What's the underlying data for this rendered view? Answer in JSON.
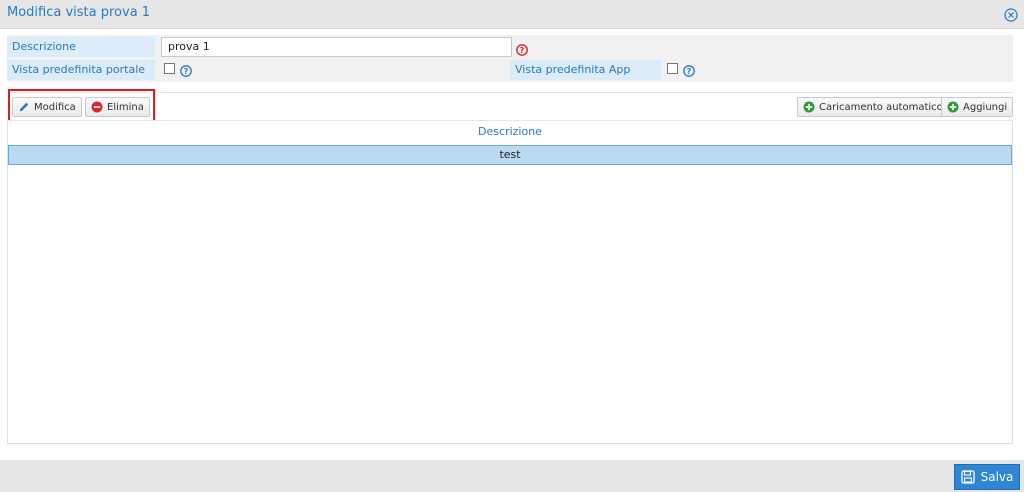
{
  "window": {
    "title": "Modifica vista prova 1"
  },
  "form": {
    "descrizione_label": "Descrizione",
    "descrizione_value": "prova 1",
    "vista_portale_label": "Vista predefinita portale",
    "vista_app_label": "Vista predefinita App"
  },
  "toolbar": {
    "modifica_label": "Modifica",
    "elimina_label": "Elimina",
    "caricamento_label": "Caricamento automatico",
    "aggiungi_label": "Aggiungi"
  },
  "grid": {
    "columns": [
      "Descrizione"
    ],
    "rows": [
      [
        "test"
      ]
    ]
  },
  "footer": {
    "save_label": "Salva"
  },
  "colors": {
    "accent": "#2a7bbd",
    "save": "#2f86d3",
    "highlight": "#e21a1a",
    "selected_row": "#bcd9f2"
  }
}
